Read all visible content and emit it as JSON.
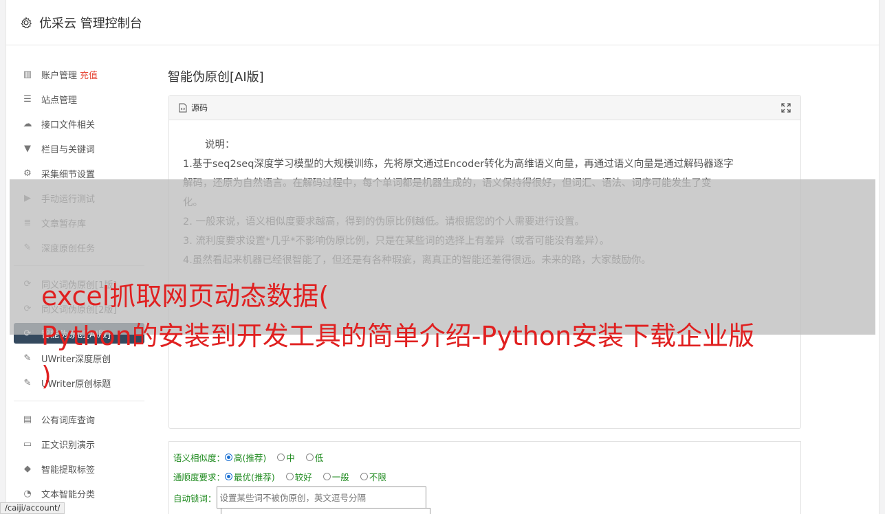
{
  "header": {
    "title": "优采云 管理控制台"
  },
  "sidebar": {
    "group1": [
      {
        "name": "sidebar-item-account",
        "icon": "bar-chart-icon",
        "glyph": "▥",
        "label": "账户管理",
        "extra": "充值"
      },
      {
        "name": "sidebar-item-sites",
        "icon": "list-icon",
        "glyph": "☰",
        "label": "站点管理"
      },
      {
        "name": "sidebar-item-api-files",
        "icon": "cloud-upload-icon",
        "glyph": "☁",
        "label": "接口文件相关"
      },
      {
        "name": "sidebar-item-columns-keywords",
        "icon": "filter-icon",
        "glyph": "▼",
        "label": "栏目与关键词"
      },
      {
        "name": "sidebar-item-collect-settings",
        "icon": "gears-icon",
        "glyph": "⚙",
        "label": "采集细节设置"
      },
      {
        "name": "sidebar-item-manual-test",
        "icon": "play-circle-icon",
        "glyph": "▶",
        "label": "手动运行测试"
      },
      {
        "name": "sidebar-item-article-store",
        "icon": "database-icon",
        "glyph": "≣",
        "label": "文章暂存库"
      },
      {
        "name": "sidebar-item-deep-original",
        "icon": "edit-icon",
        "glyph": "✎",
        "label": "深度原创任务"
      }
    ],
    "group2": [
      {
        "name": "sidebar-item-synonym-v1",
        "icon": "refresh-icon",
        "glyph": "⟳",
        "label": "同义词伪原创[1版]"
      },
      {
        "name": "sidebar-item-synonym-v2",
        "icon": "refresh-icon",
        "glyph": "⟳",
        "label": "同义词伪原创[2版]"
      },
      {
        "name": "sidebar-item-ai-rewrite",
        "icon": "refresh-icon",
        "glyph": "⟳",
        "label": "智能伪原创[AI版]",
        "active": true
      },
      {
        "name": "sidebar-item-uwriter-deep",
        "icon": "edit-icon",
        "glyph": "✎",
        "label": "UWriter深度原创"
      },
      {
        "name": "sidebar-item-uwriter-title",
        "icon": "edit-icon",
        "glyph": "✎",
        "label": "UWriter原创标题"
      }
    ],
    "group3": [
      {
        "name": "sidebar-item-public-dict",
        "icon": "book-icon",
        "glyph": "▤",
        "label": "公有词库查询"
      },
      {
        "name": "sidebar-item-text-recognition",
        "icon": "monitor-icon",
        "glyph": "▭",
        "label": "正文识别演示"
      },
      {
        "name": "sidebar-item-tag-extract",
        "icon": "tag-icon",
        "glyph": "◆",
        "label": "智能提取标签"
      },
      {
        "name": "sidebar-item-text-classify",
        "icon": "pie-chart-icon",
        "glyph": "◔",
        "label": "文本智能分类"
      }
    ]
  },
  "main": {
    "title": "智能伪原创[AI版]",
    "panel": {
      "head_label": "源码",
      "intro": "说明：",
      "lines": [
        "1.基于seq2seq深度学习模型的大规模训练，先将原文通过Encoder转化为高维语义向量，再通过语义向量是通过解码器逐字",
        "解码，还原为自然语言。在解码过程中，每个单词都是机器生成的，语义保持得很好，但词汇、语法、词序可能发生了变",
        "化。",
        "2. 一般来说，语义相似度要求越高，得到的伪原比例越低。请根据您的个人需要进行设置。",
        "3. 流利度要求设置*几乎*不影响伪原比例，只是在某些词的选择上有差异（或者可能没有差异）。",
        "4.虽然看起来机器已经很智能了，但还是有各种瑕疵，离真正的智能还差得很远。未来的路，大家鼓励你。"
      ]
    },
    "form": {
      "similarity_label": "语义相似度：",
      "similarity_options": [
        "高(推荐)",
        "中",
        "低"
      ],
      "fluency_label": "通顺度要求：",
      "fluency_options": [
        "最优(推荐)",
        "较好",
        "一般",
        "不限"
      ],
      "lock_label": "自动锁词：",
      "lock_placeholder": "设置某些词不被伪原创，英文逗号分隔"
    }
  },
  "overlay": {
    "line1": "excel抓取网页动态数据(",
    "line2": "Python的安装到开发工具的简单介绍-Python安装下载企业版",
    "line3": ")"
  },
  "statusbar": {
    "url": "/caiji/account/"
  }
}
